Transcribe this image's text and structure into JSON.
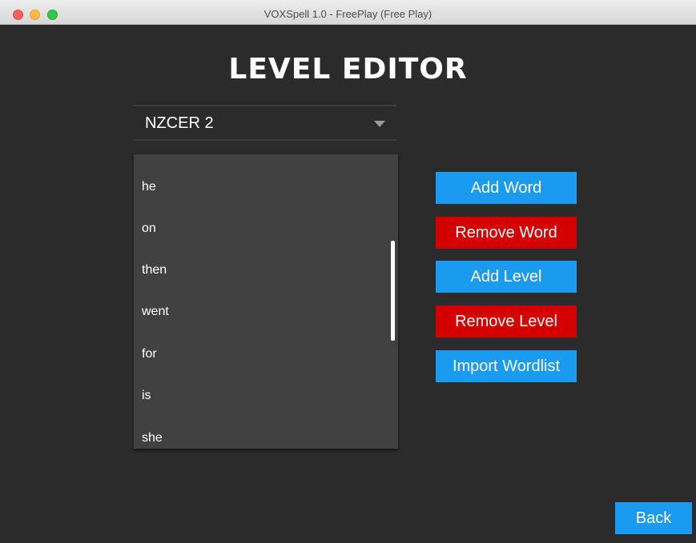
{
  "window": {
    "title": "VOXSpell 1.0 - FreePlay (Free Play)"
  },
  "page": {
    "heading": "LEVEL EDITOR"
  },
  "level_select": {
    "selected": "NZCER 2",
    "icon": "chevron-down-icon"
  },
  "word_list": {
    "items": [
      "he",
      "on",
      "then",
      "went",
      "for",
      "is",
      "she"
    ]
  },
  "actions": {
    "add_word": "Add Word",
    "remove_word": "Remove Word",
    "add_level": "Add Level",
    "remove_level": "Remove Level",
    "import_wordlist": "Import Wordlist"
  },
  "navigation": {
    "back": "Back"
  },
  "colors": {
    "background": "#2b2b2b",
    "list_background": "#414141",
    "primary_blue": "#1a9bf0",
    "danger_red": "#d40000",
    "text": "#ffffff"
  }
}
